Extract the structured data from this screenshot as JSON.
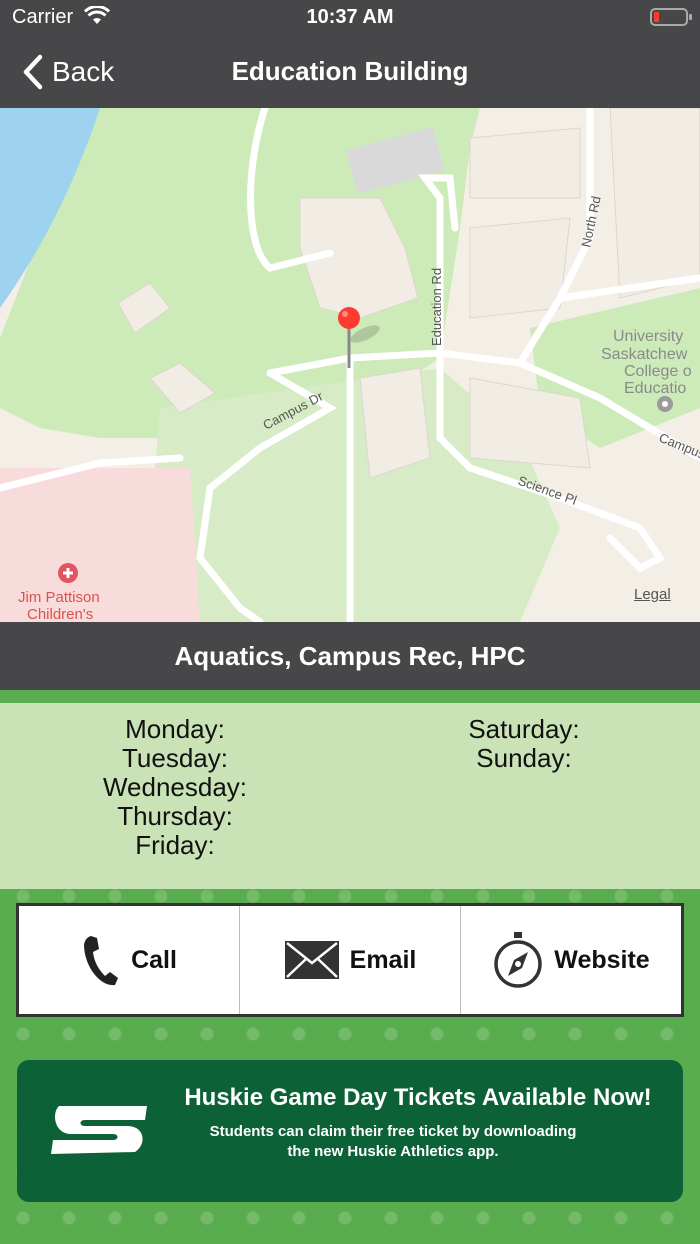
{
  "status_bar": {
    "carrier": "Carrier",
    "time": "10:37 AM",
    "battery_icon": "battery-low-icon",
    "wifi_icon": "wifi-icon"
  },
  "nav": {
    "back_label": "Back",
    "title": "Education Building"
  },
  "map": {
    "labels": {
      "campus_dr": "Campus Dr",
      "education_rd": "Education Rd",
      "north_rd": "North Rd",
      "science_pl": "Science Pl",
      "campus_right": "Campus",
      "univ_1": "University",
      "univ_2": "Saskatchew",
      "univ_3": "College o",
      "univ_4": "Educatio",
      "hospital_1": "Jim Pattison",
      "hospital_2": "Children's"
    },
    "legal": "Legal",
    "pin_color": "#ff3b30"
  },
  "facility": {
    "name": "Aquatics, Campus Rec, HPC"
  },
  "hours": {
    "weekdays": [
      "Monday:",
      "Tuesday:",
      "Wednesday:",
      "Thursday:",
      "Friday:"
    ],
    "weekend": [
      "Saturday:",
      "Sunday:"
    ]
  },
  "actions": {
    "call": "Call",
    "email": "Email",
    "website": "Website"
  },
  "banner": {
    "headline": "Huskie Game Day Tickets Available Now!",
    "sub_line1": "Students can claim their free ticket by downloading",
    "sub_line2": "the new Huskie Athletics app.",
    "bg_color": "#0d6137"
  },
  "colors": {
    "bar": "#47474a",
    "green_bg": "#5aad4e",
    "hours_bg": "#c9e3b7"
  }
}
